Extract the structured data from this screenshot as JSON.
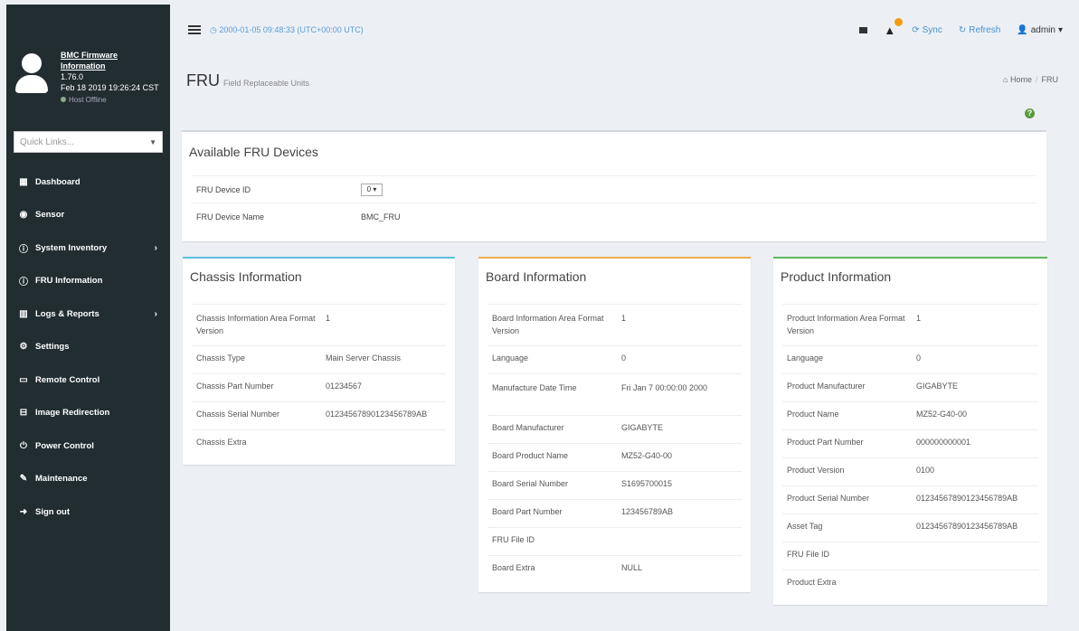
{
  "header": {
    "clock": "2000-01-05 09:48:33 (UTC+00:00 UTC)",
    "sync_label": "Sync",
    "refresh_label": "Refresh",
    "user_label": "admin"
  },
  "user_panel": {
    "fw_title": "BMC Firmware Information",
    "fw_version": "1.76.0",
    "fw_date": "Feb 18 2019 19:26:24 CST",
    "host_status": "Host Offline"
  },
  "sidebar": {
    "quick_links_placeholder": "Quick Links...",
    "items": [
      {
        "label": "Dashboard",
        "icon": "dashboard-icon"
      },
      {
        "label": "Sensor",
        "icon": "sensor-icon"
      },
      {
        "label": "System Inventory",
        "icon": "info-icon",
        "has_children": true
      },
      {
        "label": "FRU Information",
        "icon": "info-icon"
      },
      {
        "label": "Logs & Reports",
        "icon": "chart-icon",
        "has_children": true
      },
      {
        "label": "Settings",
        "icon": "gear-icon"
      },
      {
        "label": "Remote Control",
        "icon": "monitor-icon"
      },
      {
        "label": "Image Redirection",
        "icon": "disk-icon"
      },
      {
        "label": "Power Control",
        "icon": "power-icon"
      },
      {
        "label": "Maintenance",
        "icon": "wrench-icon"
      },
      {
        "label": "Sign out",
        "icon": "signout-icon"
      }
    ]
  },
  "page": {
    "title": "FRU",
    "subtitle": "Field Replaceable Units",
    "breadcrumb": [
      "Home",
      "FRU"
    ]
  },
  "available": {
    "title": "Available FRU Devices",
    "device_id_label": "FRU Device ID",
    "device_id_value": "0",
    "device_name_label": "FRU Device Name",
    "device_name_value": "BMC_FRU"
  },
  "chassis": {
    "title": "Chassis Information",
    "rows": [
      {
        "k": "Chassis Information Area Format Version",
        "v": "1"
      },
      {
        "k": "Chassis Type",
        "v": "Main Server Chassis"
      },
      {
        "k": "Chassis Part Number",
        "v": "01234567"
      },
      {
        "k": "Chassis Serial Number",
        "v": "01234567890123456789AB"
      },
      {
        "k": "Chassis Extra",
        "v": ""
      }
    ]
  },
  "board": {
    "title": "Board Information",
    "rows": [
      {
        "k": "Board Information Area Format Version",
        "v": "1"
      },
      {
        "k": "Language",
        "v": "0"
      },
      {
        "k": "Manufacture Date Time",
        "v": "Fri Jan 7 00:00:00 2000"
      },
      {
        "k": "Board Manufacturer",
        "v": "GIGABYTE"
      },
      {
        "k": "Board Product Name",
        "v": "MZ52-G40-00"
      },
      {
        "k": "Board Serial Number",
        "v": "S1695700015"
      },
      {
        "k": "Board Part Number",
        "v": "123456789AB"
      },
      {
        "k": "FRU File ID",
        "v": ""
      },
      {
        "k": "Board Extra",
        "v": "NULL"
      }
    ]
  },
  "product": {
    "title": "Product Information",
    "rows": [
      {
        "k": "Product Information Area Format Version",
        "v": "1"
      },
      {
        "k": "Language",
        "v": "0"
      },
      {
        "k": "Product Manufacturer",
        "v": "GIGABYTE"
      },
      {
        "k": "Product Name",
        "v": "MZ52-G40-00"
      },
      {
        "k": "Product Part Number",
        "v": "000000000001"
      },
      {
        "k": "Product Version",
        "v": "0100"
      },
      {
        "k": "Product Serial Number",
        "v": "01234567890123456789AB"
      },
      {
        "k": "Asset Tag",
        "v": "01234567890123456789AB"
      },
      {
        "k": "FRU File ID",
        "v": ""
      },
      {
        "k": "Product Extra",
        "v": ""
      }
    ]
  },
  "colors": {
    "sidebar_bg": "#222d32",
    "chassis_accent": "#5bc0de",
    "board_accent": "#f0ad4e",
    "product_accent": "#5cb85c",
    "link": "#4a90c9"
  }
}
